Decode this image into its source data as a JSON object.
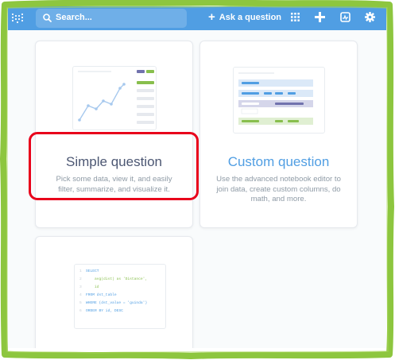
{
  "colors": {
    "brand": "#509ee3",
    "highlight": "#e8001b",
    "frame": "#8dc63f",
    "summarize": "#88bf4d",
    "title_dark": "#4c5773",
    "title_blue": "#509ee3"
  },
  "header": {
    "logo_icon": "metabase-logo-icon",
    "search_placeholder": "Search...",
    "ask_label": "Ask a question",
    "icons": [
      "browse-grid-icon",
      "plus-icon",
      "pulse-icon",
      "gear-icon"
    ]
  },
  "cards": {
    "simple": {
      "title": "Simple question",
      "description": "Pick some data, view it, and easily filter, summarize, and visualize it."
    },
    "custom": {
      "title": "Custom question",
      "description": "Use the advanced notebook editor to join data, create custom columns, do math, and more."
    },
    "native": {
      "sql_lines": [
        {
          "n": "1",
          "code": "SELECT"
        },
        {
          "n": "2",
          "code": "    avg(dist) as 'Distance',"
        },
        {
          "n": "3",
          "code": "    id"
        },
        {
          "n": "4",
          "code": "FROM dst_table"
        },
        {
          "n": "5",
          "code": "WHERE (dst_value = 'guinda')"
        },
        {
          "n": "6",
          "code": "ORDER BY id, DESC"
        }
      ]
    }
  }
}
